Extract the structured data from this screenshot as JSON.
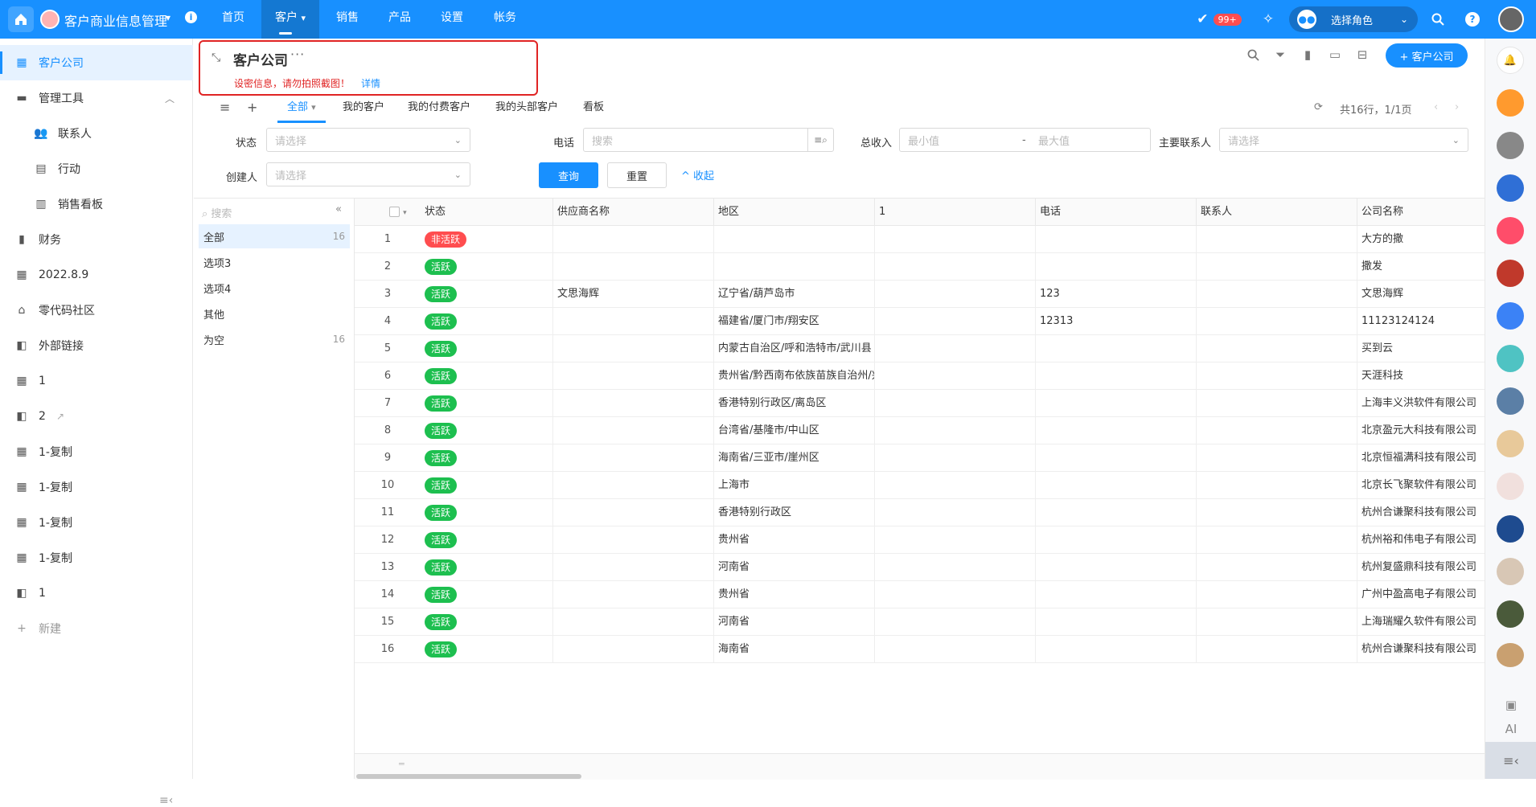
{
  "colors": {
    "primary": "#1890ff",
    "danger": "#ff4d4f",
    "success": "#1dbf4f",
    "alert_border": "#e02424"
  },
  "topbar": {
    "app_title": "客户商业信息管理",
    "nav": [
      {
        "label": "首页",
        "active": false
      },
      {
        "label": "客户",
        "active": true
      },
      {
        "label": "销售",
        "active": false
      },
      {
        "label": "产品",
        "active": false
      },
      {
        "label": "设置",
        "active": false
      },
      {
        "label": "帐务",
        "active": false
      }
    ],
    "notification_badge": "99+",
    "role_select": "选择角色",
    "icons": [
      "home-icon",
      "info-icon",
      "check-circle-icon",
      "sparkle-icon",
      "users-icon",
      "search-icon",
      "help-icon"
    ]
  },
  "sidebar": {
    "items": [
      {
        "label": "客户公司",
        "icon": "building-icon",
        "active": true
      },
      {
        "label": "管理工具",
        "icon": "folder-icon",
        "active": false
      },
      {
        "label": "联系人",
        "icon": "contacts-icon",
        "active": false
      },
      {
        "label": "行动",
        "icon": "calendar-icon",
        "active": false
      },
      {
        "label": "销售看板",
        "icon": "kanban-icon",
        "active": false
      },
      {
        "label": "财务",
        "icon": "bar-chart-icon",
        "active": false
      },
      {
        "label": "2022.8.9",
        "icon": "table-icon",
        "active": false
      },
      {
        "label": "零代码社区",
        "icon": "home-icon",
        "active": false
      },
      {
        "label": "外部链接",
        "icon": "widgets-icon",
        "active": false
      },
      {
        "label": "1",
        "icon": "table-icon",
        "active": false
      },
      {
        "label": "2",
        "icon": "widgets-icon",
        "active": false
      },
      {
        "label": "1-复制",
        "icon": "table-icon",
        "active": false
      },
      {
        "label": "1-复制",
        "icon": "table-icon",
        "active": false
      },
      {
        "label": "1-复制",
        "icon": "table-icon",
        "active": false
      },
      {
        "label": "1-复制",
        "icon": "table-icon",
        "active": false
      },
      {
        "label": "1",
        "icon": "widgets-icon",
        "active": false
      }
    ],
    "new_label": "新建"
  },
  "page": {
    "title": "客户公司",
    "warning": "设密信息，请勿拍照截图！",
    "warning_link": "详情",
    "add_button": "+ 客户公司"
  },
  "tabs": [
    {
      "label": "全部",
      "active": true
    },
    {
      "label": "我的客户",
      "active": false
    },
    {
      "label": "我的付费客户",
      "active": false
    },
    {
      "label": "我的头部客户",
      "active": false
    },
    {
      "label": "看板",
      "active": false
    }
  ],
  "pager": {
    "summary": "共16行，1/1页"
  },
  "filters": {
    "status_label": "状态",
    "status_placeholder": "请选择",
    "phone_label": "电话",
    "phone_placeholder": "搜索",
    "revenue_label": "总收入",
    "revenue_min": "最小值",
    "revenue_sep": "-",
    "revenue_max": "最大值",
    "contact_label": "主要联系人",
    "contact_placeholder": "请选择",
    "creator_label": "创建人",
    "creator_placeholder": "请选择",
    "query_button": "查询",
    "reset_button": "重置",
    "collapse_link": "收起"
  },
  "groups": {
    "search_placeholder": "搜索",
    "items": [
      {
        "label": "全部",
        "count": "16",
        "active": true
      },
      {
        "label": "选项3",
        "count": "",
        "active": false
      },
      {
        "label": "选项4",
        "count": "",
        "active": false
      },
      {
        "label": "其他",
        "count": "",
        "active": false
      },
      {
        "label": "为空",
        "count": "16",
        "active": false
      }
    ]
  },
  "table": {
    "columns": [
      "状态",
      "供应商名称",
      "地区",
      "1",
      "电话",
      "联系人",
      "公司名称"
    ],
    "rows": [
      {
        "no": "1",
        "status": "非活跃",
        "inactive": true,
        "supplier": "",
        "region": "",
        "c1": "",
        "phone": "",
        "contact": "",
        "company": "大方的撒"
      },
      {
        "no": "2",
        "status": "活跃",
        "inactive": false,
        "supplier": "",
        "region": "",
        "c1": "",
        "phone": "",
        "contact": "",
        "company": "撒发"
      },
      {
        "no": "3",
        "status": "活跃",
        "inactive": false,
        "supplier": "文思海辉",
        "region": "辽宁省/葫芦岛市",
        "c1": "",
        "phone": "123",
        "contact": "",
        "company": "文思海辉"
      },
      {
        "no": "4",
        "status": "活跃",
        "inactive": false,
        "supplier": "",
        "region": "福建省/厦门市/翔安区",
        "c1": "",
        "phone": "12313",
        "contact": "",
        "company": "11123124124"
      },
      {
        "no": "5",
        "status": "活跃",
        "inactive": false,
        "supplier": "",
        "region": "内蒙古自治区/呼和浩特市/武川县",
        "c1": "",
        "phone": "",
        "contact": "",
        "company": "买到云"
      },
      {
        "no": "6",
        "status": "活跃",
        "inactive": false,
        "supplier": "",
        "region": "贵州省/黔西南布依族苗族自治州/兴义市",
        "c1": "",
        "phone": "",
        "contact": "",
        "company": "天涯科技"
      },
      {
        "no": "7",
        "status": "活跃",
        "inactive": false,
        "supplier": "",
        "region": "香港特别行政区/离岛区",
        "c1": "",
        "phone": "",
        "contact": "",
        "company": "上海丰义洪软件有限公司"
      },
      {
        "no": "8",
        "status": "活跃",
        "inactive": false,
        "supplier": "",
        "region": "台湾省/基隆市/中山区",
        "c1": "",
        "phone": "",
        "contact": "",
        "company": "北京盈元大科技有限公司"
      },
      {
        "no": "9",
        "status": "活跃",
        "inactive": false,
        "supplier": "",
        "region": "海南省/三亚市/崖州区",
        "c1": "",
        "phone": "",
        "contact": "",
        "company": "北京恒福满科技有限公司"
      },
      {
        "no": "10",
        "status": "活跃",
        "inactive": false,
        "supplier": "",
        "region": "上海市",
        "c1": "",
        "phone": "",
        "contact": "",
        "company": "北京长飞聚软件有限公司"
      },
      {
        "no": "11",
        "status": "活跃",
        "inactive": false,
        "supplier": "",
        "region": "香港特别行政区",
        "c1": "",
        "phone": "",
        "contact": "",
        "company": "杭州合谦聚科技有限公司"
      },
      {
        "no": "12",
        "status": "活跃",
        "inactive": false,
        "supplier": "",
        "region": "贵州省",
        "c1": "",
        "phone": "",
        "contact": "",
        "company": "杭州裕和伟电子有限公司"
      },
      {
        "no": "13",
        "status": "活跃",
        "inactive": false,
        "supplier": "",
        "region": "河南省",
        "c1": "",
        "phone": "",
        "contact": "",
        "company": "杭州复盛鼎科技有限公司"
      },
      {
        "no": "14",
        "status": "活跃",
        "inactive": false,
        "supplier": "",
        "region": "贵州省",
        "c1": "",
        "phone": "",
        "contact": "",
        "company": "广州中盈高电子有限公司"
      },
      {
        "no": "15",
        "status": "活跃",
        "inactive": false,
        "supplier": "",
        "region": "河南省",
        "c1": "",
        "phone": "",
        "contact": "",
        "company": "上海瑞耀久软件有限公司"
      },
      {
        "no": "16",
        "status": "活跃",
        "inactive": false,
        "supplier": "",
        "region": "海南省",
        "c1": "",
        "phone": "",
        "contact": "",
        "company": "杭州合谦聚科技有限公司"
      }
    ]
  },
  "right_rail": {
    "ai_label": "AI"
  }
}
